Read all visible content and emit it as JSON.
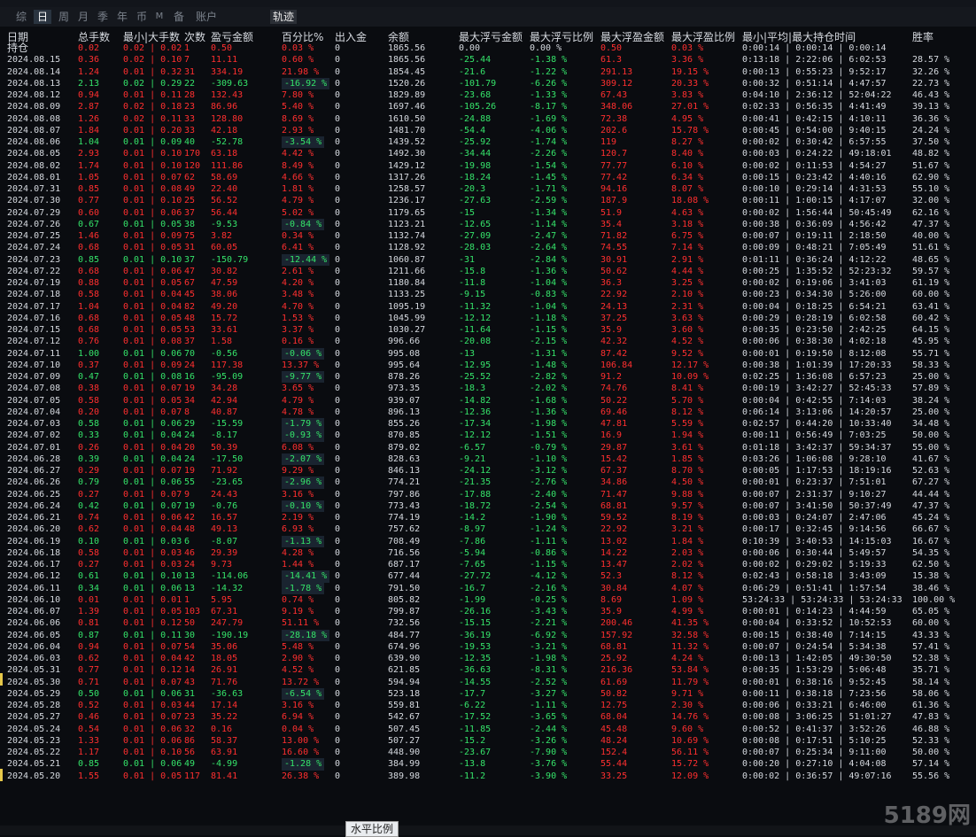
{
  "tabs": [
    "综",
    "日",
    "周",
    "月",
    "季",
    "年",
    "币",
    "M",
    "备",
    "账户"
  ],
  "active_tab": "日",
  "track_button": "轨迹",
  "scroll_button": "水平比例",
  "watermark": "5189网",
  "columns": [
    "日期",
    "总手数",
    "最小|大手数",
    "次数",
    "盈亏金额",
    "百分比%",
    "出入金",
    "余额",
    "最大浮亏金额",
    "最大浮亏比例",
    "最大浮盈金额",
    "最大浮盈比例",
    "最小|平均|最大持仓时间",
    "胜率"
  ],
  "holding_row": {
    "label": "持仓",
    "vol": "0.02",
    "minmax": "0.02 | 0.02",
    "count": "1",
    "pnl": "0.50",
    "pct": "0.03 %",
    "io": "0",
    "bal": "1865.56",
    "mfl": "0.00",
    "mflp": "0.00 %",
    "mfp": "0.50",
    "mfpp": "0.03 %",
    "time": "0:00:14 | 0:00:14 | 0:00:14",
    "win": ""
  },
  "rows": [
    [
      "2024.08.15",
      "0.36",
      "0.02 | 0.10",
      "7",
      "11.11",
      "0.60 %",
      "0",
      "1865.56",
      "-25.44",
      "-1.38 %",
      "61.3",
      "3.36 %",
      "0:13:18 | 2:22:06 | 6:02:53",
      "28.57 %"
    ],
    [
      "2024.08.14",
      "1.24",
      "0.01 | 0.32",
      "31",
      "334.19",
      "21.98 %",
      "0",
      "1854.45",
      "-21.6",
      "-1.22 %",
      "291.13",
      "19.15 %",
      "0:00:13 | 0:55:23 | 9:52:17",
      "32.26 %"
    ],
    [
      "2024.08.13",
      "2.13",
      "0.02 | 0.29",
      "22",
      "-309.63",
      "-16.92 %",
      "0",
      "1520.26",
      "-101.79",
      "-6.26 %",
      "309.12",
      "20.33 %",
      "0:00:32 | 0:51:14 | 4:47:57",
      "22.73 %"
    ],
    [
      "2024.08.12",
      "0.94",
      "0.01 | 0.11",
      "28",
      "132.43",
      "7.80 %",
      "0",
      "1829.89",
      "-23.68",
      "-1.33 %",
      "67.43",
      "3.83 %",
      "0:04:10 | 2:36:12 | 52:04:22",
      "46.43 %"
    ],
    [
      "2024.08.09",
      "2.87",
      "0.02 | 0.18",
      "23",
      "86.96",
      "5.40 %",
      "0",
      "1697.46",
      "-105.26",
      "-8.17 %",
      "348.06",
      "27.01 %",
      "0:02:33 | 0:56:35 | 4:41:49",
      "39.13 %"
    ],
    [
      "2024.08.08",
      "1.26",
      "0.02 | 0.11",
      "33",
      "128.80",
      "8.69 %",
      "0",
      "1610.50",
      "-24.88",
      "-1.69 %",
      "72.38",
      "4.95 %",
      "0:00:41 | 0:42:15 | 4:10:11",
      "36.36 %"
    ],
    [
      "2024.08.07",
      "1.84",
      "0.01 | 0.20",
      "33",
      "42.18",
      "2.93 %",
      "0",
      "1481.70",
      "-54.4",
      "-4.06 %",
      "202.6",
      "15.78 %",
      "0:00:45 | 0:54:00 | 9:40:15",
      "24.24 %"
    ],
    [
      "2024.08.06",
      "1.04",
      "0.01 | 0.09",
      "40",
      "-52.78",
      "-3.54 %",
      "0",
      "1439.52",
      "-25.92",
      "-1.74 %",
      "119",
      "8.27 %",
      "0:00:02 | 0:30:42 | 6:57:55",
      "37.50 %"
    ],
    [
      "2024.08.05",
      "2.93",
      "0.01 | 0.10",
      "170",
      "63.18",
      "4.42 %",
      "0",
      "1492.30",
      "-34.44",
      "-2.26 %",
      "120.7",
      "8.40 %",
      "0:00:03 | 0:24:22 | 49:18:01",
      "48.82 %"
    ],
    [
      "2024.08.02",
      "1.74",
      "0.01 | 0.10",
      "120",
      "111.86",
      "8.49 %",
      "0",
      "1429.12",
      "-19.98",
      "-1.54 %",
      "77.77",
      "6.10 %",
      "0:00:02 | 0:11:53 | 4:54:27",
      "51.67 %"
    ],
    [
      "2024.08.01",
      "1.05",
      "0.01 | 0.07",
      "62",
      "58.69",
      "4.66 %",
      "0",
      "1317.26",
      "-18.24",
      "-1.45 %",
      "77.42",
      "6.34 %",
      "0:00:15 | 0:23:42 | 4:40:16",
      "62.90 %"
    ],
    [
      "2024.07.31",
      "0.85",
      "0.01 | 0.08",
      "49",
      "22.40",
      "1.81 %",
      "0",
      "1258.57",
      "-20.3",
      "-1.71 %",
      "94.16",
      "8.07 %",
      "0:00:10 | 0:29:14 | 4:31:53",
      "55.10 %"
    ],
    [
      "2024.07.30",
      "0.77",
      "0.01 | 0.10",
      "25",
      "56.52",
      "4.79 %",
      "0",
      "1236.17",
      "-27.63",
      "-2.59 %",
      "187.9",
      "18.08 %",
      "0:00:11 | 1:00:15 | 4:17:07",
      "32.00 %"
    ],
    [
      "2024.07.29",
      "0.60",
      "0.01 | 0.06",
      "37",
      "56.44",
      "5.02 %",
      "0",
      "1179.65",
      "-15",
      "-1.34 %",
      "51.9",
      "4.63 %",
      "0:00:02 | 1:56:44 | 50:45:49",
      "62.16 %"
    ],
    [
      "2024.07.26",
      "0.67",
      "0.01 | 0.05",
      "38",
      "-9.53",
      "-0.84 %",
      "0",
      "1123.21",
      "-12.65",
      "-1.14 %",
      "35.4",
      "3.18 %",
      "0:00:38 | 0:36:09 | 4:56:42",
      "47.37 %"
    ],
    [
      "2024.07.25",
      "1.46",
      "0.01 | 0.09",
      "75",
      "3.82",
      "0.34 %",
      "0",
      "1132.74",
      "-27.09",
      "-2.47 %",
      "71.82",
      "6.75 %",
      "0:00:07 | 0:19:11 | 2:18:50",
      "40.00 %"
    ],
    [
      "2024.07.24",
      "0.68",
      "0.01 | 0.05",
      "31",
      "60.05",
      "6.41 %",
      "0",
      "1128.92",
      "-28.03",
      "-2.64 %",
      "74.55",
      "7.14 %",
      "0:00:09 | 0:48:21 | 7:05:49",
      "51.61 %"
    ],
    [
      "2024.07.23",
      "0.85",
      "0.01 | 0.10",
      "37",
      "-150.79",
      "-12.44 %",
      "0",
      "1060.87",
      "-31",
      "-2.84 %",
      "30.91",
      "2.91 %",
      "0:01:11 | 0:36:24 | 4:12:22",
      "48.65 %"
    ],
    [
      "2024.07.22",
      "0.68",
      "0.01 | 0.06",
      "47",
      "30.82",
      "2.61 %",
      "0",
      "1211.66",
      "-15.8",
      "-1.36 %",
      "50.62",
      "4.44 %",
      "0:00:25 | 1:35:52 | 52:23:32",
      "59.57 %"
    ],
    [
      "2024.07.19",
      "0.88",
      "0.01 | 0.05",
      "67",
      "47.59",
      "4.20 %",
      "0",
      "1180.84",
      "-11.8",
      "-1.04 %",
      "36.3",
      "3.25 %",
      "0:00:02 | 0:19:06 | 3:41:03",
      "61.19 %"
    ],
    [
      "2024.07.18",
      "0.58",
      "0.01 | 0.04",
      "45",
      "38.06",
      "3.48 %",
      "0",
      "1133.25",
      "-9.15",
      "-0.83 %",
      "22.92",
      "2.10 %",
      "0:00:23 | 0:34:30 | 5:26:00",
      "60.00 %"
    ],
    [
      "2024.07.17",
      "1.04",
      "0.01 | 0.04",
      "82",
      "49.20",
      "4.70 %",
      "0",
      "1095.19",
      "-11.32",
      "-1.04 %",
      "24.13",
      "2.31 %",
      "0:00:04 | 0:18:25 | 6:54:21",
      "63.41 %"
    ],
    [
      "2024.07.16",
      "0.68",
      "0.01 | 0.05",
      "48",
      "15.72",
      "1.53 %",
      "0",
      "1045.99",
      "-12.12",
      "-1.18 %",
      "37.25",
      "3.63 %",
      "0:00:29 | 0:28:19 | 6:02:58",
      "60.42 %"
    ],
    [
      "2024.07.15",
      "0.68",
      "0.01 | 0.05",
      "53",
      "33.61",
      "3.37 %",
      "0",
      "1030.27",
      "-11.64",
      "-1.15 %",
      "35.9",
      "3.60 %",
      "0:00:35 | 0:23:50 | 2:42:25",
      "64.15 %"
    ],
    [
      "2024.07.12",
      "0.76",
      "0.01 | 0.08",
      "37",
      "1.58",
      "0.16 %",
      "0",
      "996.66",
      "-20.08",
      "-2.15 %",
      "42.32",
      "4.52 %",
      "0:00:06 | 0:38:30 | 4:02:18",
      "45.95 %"
    ],
    [
      "2024.07.11",
      "1.00",
      "0.01 | 0.06",
      "70",
      "-0.56",
      "-0.06 %",
      "0",
      "995.08",
      "-13",
      "-1.31 %",
      "87.42",
      "9.52 %",
      "0:00:01 | 0:19:50 | 8:12:08",
      "55.71 %"
    ],
    [
      "2024.07.10",
      "0.37",
      "0.01 | 0.09",
      "24",
      "117.38",
      "13.37 %",
      "0",
      "995.64",
      "-12.95",
      "-1.48 %",
      "106.84",
      "12.17 %",
      "0:00:38 | 1:01:39 | 17:20:33",
      "58.33 %"
    ],
    [
      "2024.07.09",
      "0.47",
      "0.01 | 0.08",
      "16",
      "-95.09",
      "-9.77 %",
      "0",
      "878.26",
      "-25.52",
      "-2.82 %",
      "91.2",
      "10.09 %",
      "0:02:25 | 1:36:08 | 6:57:23",
      "25.00 %"
    ],
    [
      "2024.07.08",
      "0.38",
      "0.01 | 0.07",
      "19",
      "34.28",
      "3.65 %",
      "0",
      "973.35",
      "-18.3",
      "-2.02 %",
      "74.76",
      "8.41 %",
      "0:00:19 | 3:42:27 | 52:45:33",
      "57.89 %"
    ],
    [
      "2024.07.05",
      "0.58",
      "0.01 | 0.05",
      "34",
      "42.94",
      "4.79 %",
      "0",
      "939.07",
      "-14.82",
      "-1.68 %",
      "50.22",
      "5.70 %",
      "0:00:04 | 0:42:55 | 7:14:03",
      "38.24 %"
    ],
    [
      "2024.07.04",
      "0.20",
      "0.01 | 0.07",
      "8",
      "40.87",
      "4.78 %",
      "0",
      "896.13",
      "-12.36",
      "-1.36 %",
      "69.46",
      "8.12 %",
      "0:06:14 | 3:13:06 | 14:20:57",
      "25.00 %"
    ],
    [
      "2024.07.03",
      "0.58",
      "0.01 | 0.06",
      "29",
      "-15.59",
      "-1.79 %",
      "0",
      "855.26",
      "-17.34",
      "-1.98 %",
      "47.81",
      "5.59 %",
      "0:02:57 | 0:44:20 | 10:33:40",
      "34.48 %"
    ],
    [
      "2024.07.02",
      "0.33",
      "0.01 | 0.04",
      "24",
      "-8.17",
      "-0.93 %",
      "0",
      "870.85",
      "-12.12",
      "-1.51 %",
      "16.9",
      "1.94 %",
      "0:00:11 | 0:56:49 | 7:03:25",
      "50.00 %"
    ],
    [
      "2024.07.01",
      "0.26",
      "0.01 | 0.04",
      "20",
      "50.39",
      "6.08 %",
      "0",
      "879.02",
      "-6.57",
      "-0.79 %",
      "29.87",
      "3.61 %",
      "0:01:18 | 3:42:37 | 59:34:37",
      "55.00 %"
    ],
    [
      "2024.06.28",
      "0.39",
      "0.01 | 0.04",
      "24",
      "-17.50",
      "-2.07 %",
      "0",
      "828.63",
      "-9.21",
      "-1.10 %",
      "15.42",
      "1.85 %",
      "0:03:26 | 1:06:08 | 9:28:10",
      "41.67 %"
    ],
    [
      "2024.06.27",
      "0.29",
      "0.01 | 0.07",
      "19",
      "71.92",
      "9.29 %",
      "0",
      "846.13",
      "-24.12",
      "-3.12 %",
      "67.37",
      "8.70 %",
      "0:00:05 | 1:17:53 | 18:19:16",
      "52.63 %"
    ],
    [
      "2024.06.26",
      "0.79",
      "0.01 | 0.06",
      "55",
      "-23.65",
      "-2.96 %",
      "0",
      "774.21",
      "-21.35",
      "-2.76 %",
      "34.86",
      "4.50 %",
      "0:00:01 | 0:23:37 | 7:51:01",
      "67.27 %"
    ],
    [
      "2024.06.25",
      "0.27",
      "0.01 | 0.07",
      "9",
      "24.43",
      "3.16 %",
      "0",
      "797.86",
      "-17.88",
      "-2.40 %",
      "71.47",
      "9.88 %",
      "0:00:07 | 2:31:37 | 9:10:27",
      "44.44 %"
    ],
    [
      "2024.06.24",
      "0.42",
      "0.01 | 0.07",
      "19",
      "-0.76",
      "-0.10 %",
      "0",
      "773.43",
      "-18.72",
      "-2.54 %",
      "68.81",
      "9.57 %",
      "0:00:07 | 3:41:50 | 50:37:49",
      "47.37 %"
    ],
    [
      "2024.06.21",
      "0.74",
      "0.01 | 0.06",
      "42",
      "16.57",
      "2.19 %",
      "0",
      "774.19",
      "-14.2",
      "-1.90 %",
      "59.52",
      "8.19 %",
      "0:00:03 | 0:24:07 | 2:47:06",
      "45.24 %"
    ],
    [
      "2024.06.20",
      "0.62",
      "0.01 | 0.04",
      "48",
      "49.13",
      "6.93 %",
      "0",
      "757.62",
      "-8.97",
      "-1.24 %",
      "22.92",
      "3.21 %",
      "0:00:17 | 0:32:45 | 9:14:56",
      "66.67 %"
    ],
    [
      "2024.06.19",
      "0.10",
      "0.01 | 0.03",
      "6",
      "-8.07",
      "-1.13 %",
      "0",
      "708.49",
      "-7.86",
      "-1.11 %",
      "13.02",
      "1.84 %",
      "0:10:39 | 3:40:53 | 14:15:03",
      "16.67 %"
    ],
    [
      "2024.06.18",
      "0.58",
      "0.01 | 0.03",
      "46",
      "29.39",
      "4.28 %",
      "0",
      "716.56",
      "-5.94",
      "-0.86 %",
      "14.22",
      "2.03 %",
      "0:00:06 | 0:30:44 | 5:49:57",
      "54.35 %"
    ],
    [
      "2024.06.17",
      "0.27",
      "0.01 | 0.03",
      "24",
      "9.73",
      "1.44 %",
      "0",
      "687.17",
      "-7.65",
      "-1.15 %",
      "13.47",
      "2.02 %",
      "0:00:02 | 0:29:02 | 5:19:33",
      "62.50 %"
    ],
    [
      "2024.06.12",
      "0.61",
      "0.01 | 0.10",
      "13",
      "-114.06",
      "-14.41 %",
      "0",
      "677.44",
      "-27.72",
      "-4.12 %",
      "52.3",
      "8.12 %",
      "0:02:43 | 0:58:18 | 3:43:09",
      "15.38 %"
    ],
    [
      "2024.06.11",
      "0.34",
      "0.01 | 0.06",
      "13",
      "-14.32",
      "-1.78 %",
      "0",
      "791.50",
      "-16.7",
      "-2.16 %",
      "30.84",
      "4.07 %",
      "0:06:29 | 0:51:41 | 1:57:54",
      "38.46 %"
    ],
    [
      "2024.06.10",
      "0.01",
      "0.01 | 0.01",
      "1",
      "5.95",
      "0.74 %",
      "0",
      "805.82",
      "-1.99",
      "-0.25 %",
      "8.69",
      "1.09 %",
      "53:24:33 | 53:24:33 | 53:24:33",
      "100.00 %"
    ],
    [
      "2024.06.07",
      "1.39",
      "0.01 | 0.05",
      "103",
      "67.31",
      "9.19 %",
      "0",
      "799.87",
      "-26.16",
      "-3.43 %",
      "35.9",
      "4.99 %",
      "0:00:01 | 0:14:23 | 4:44:59",
      "65.05 %"
    ],
    [
      "2024.06.06",
      "0.81",
      "0.01 | 0.12",
      "50",
      "247.79",
      "51.11 %",
      "0",
      "732.56",
      "-15.15",
      "-2.21 %",
      "200.46",
      "41.35 %",
      "0:00:04 | 0:33:52 | 10:52:53",
      "60.00 %"
    ],
    [
      "2024.06.05",
      "0.87",
      "0.01 | 0.11",
      "30",
      "-190.19",
      "-28.18 %",
      "0",
      "484.77",
      "-36.19",
      "-6.92 %",
      "157.92",
      "32.58 %",
      "0:00:15 | 0:38:40 | 7:14:15",
      "43.33 %"
    ],
    [
      "2024.06.04",
      "0.94",
      "0.01 | 0.07",
      "54",
      "35.06",
      "5.48 %",
      "0",
      "674.96",
      "-19.53",
      "-3.21 %",
      "68.81",
      "11.32 %",
      "0:00:07 | 0:24:54 | 5:34:38",
      "57.41 %"
    ],
    [
      "2024.06.03",
      "0.62",
      "0.01 | 0.04",
      "42",
      "18.05",
      "2.90 %",
      "0",
      "639.90",
      "-12.35",
      "-1.98 %",
      "25.92",
      "4.24 %",
      "0:00:13 | 1:42:05 | 49:30:50",
      "52.38 %"
    ],
    [
      "2024.05.31",
      "0.77",
      "0.01 | 0.12",
      "14",
      "26.91",
      "4.52 %",
      "0",
      "621.85",
      "-36.63",
      "-8.31 %",
      "216.36",
      "53.84 %",
      "0:00:35 | 1:53:29 | 5:06:48",
      "35.71 %"
    ],
    [
      "2024.05.30",
      "0.71",
      "0.01 | 0.07",
      "43",
      "71.76",
      "13.72 %",
      "0",
      "594.94",
      "-14.55",
      "-2.52 %",
      "61.69",
      "11.79 %",
      "0:00:01 | 0:38:16 | 9:52:45",
      "58.14 %"
    ],
    [
      "2024.05.29",
      "0.50",
      "0.01 | 0.06",
      "31",
      "-36.63",
      "-6.54 %",
      "0",
      "523.18",
      "-17.7",
      "-3.27 %",
      "50.82",
      "9.71 %",
      "0:00:11 | 0:38:18 | 7:23:56",
      "58.06 %"
    ],
    [
      "2024.05.28",
      "0.52",
      "0.01 | 0.03",
      "44",
      "17.14",
      "3.16 %",
      "0",
      "559.81",
      "-6.22",
      "-1.11 %",
      "12.75",
      "2.30 %",
      "0:00:06 | 0:33:21 | 6:46:00",
      "61.36 %"
    ],
    [
      "2024.05.27",
      "0.46",
      "0.01 | 0.07",
      "23",
      "35.22",
      "6.94 %",
      "0",
      "542.67",
      "-17.52",
      "-3.65 %",
      "68.04",
      "14.76 %",
      "0:00:08 | 3:06:25 | 51:01:27",
      "47.83 %"
    ],
    [
      "2024.05.24",
      "0.54",
      "0.01 | 0.06",
      "32",
      "0.16",
      "0.04 %",
      "0",
      "507.45",
      "-11.85",
      "-2.44 %",
      "45.48",
      "9.60 %",
      "0:00:52 | 0:41:37 | 3:52:26",
      "46.88 %"
    ],
    [
      "2024.05.23",
      "1.33",
      "0.01 | 0.06",
      "86",
      "58.37",
      "13.00 %",
      "0",
      "507.27",
      "-15.2",
      "-3.26 %",
      "48.24",
      "10.69 %",
      "0:00:08 | 0:17:51 | 5:10:25",
      "52.33 %"
    ],
    [
      "2024.05.22",
      "1.17",
      "0.01 | 0.10",
      "56",
      "63.91",
      "16.60 %",
      "0",
      "448.90",
      "-23.67",
      "-7.90 %",
      "152.4",
      "56.11 %",
      "0:00:07 | 0:25:34 | 9:11:00",
      "50.00 %"
    ],
    [
      "2024.05.21",
      "0.85",
      "0.01 | 0.06",
      "49",
      "-4.99",
      "-1.28 %",
      "0",
      "384.99",
      "-13.8",
      "-3.76 %",
      "55.44",
      "15.72 %",
      "0:00:20 | 0:27:10 | 4:04:08",
      "57.14 %"
    ],
    [
      "2024.05.20",
      "1.55",
      "0.01 | 0.05",
      "117",
      "81.41",
      "26.38 %",
      "0",
      "389.98",
      "-11.2",
      "-3.90 %",
      "33.25",
      "12.09 %",
      "0:00:02 | 0:36:57 | 49:07:16",
      "55.56 %"
    ]
  ]
}
